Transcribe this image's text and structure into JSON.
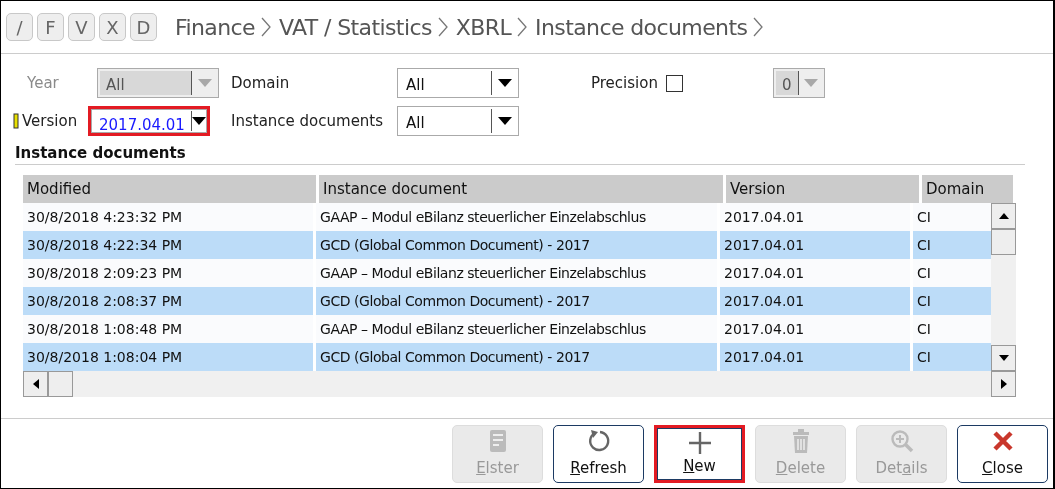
{
  "toolbar": {
    "keys": [
      "/",
      "F",
      "V",
      "X",
      "D"
    ]
  },
  "breadcrumb": [
    "Finance",
    "VAT / Statistics",
    "XBRL",
    "Instance documents"
  ],
  "filters": [
    {
      "kind": "select",
      "label": "Year",
      "value": "All",
      "disabled": true,
      "highlighted": false
    },
    {
      "kind": "select",
      "label": "Domain",
      "value": "All",
      "disabled": false,
      "highlighted": false
    },
    {
      "kind": "checkbox",
      "label": "Precision",
      "checked": false
    },
    {
      "kind": "select",
      "value": "0",
      "disabled": true,
      "highlighted": false
    },
    {
      "kind": "select",
      "label": "Version",
      "value": "2017.04.01",
      "disabled": false,
      "highlighted": true,
      "marked": true
    },
    {
      "kind": "select",
      "label": "Instance documents",
      "value": "All",
      "disabled": false,
      "highlighted": false
    }
  ],
  "section_title": "Instance documents",
  "table": {
    "columns": [
      "Modified",
      "Instance document",
      "Version",
      "Domain"
    ],
    "rows": [
      [
        "30/8/2018 4:23:32 PM",
        "GAAP – Modul eBilanz steuerlicher Einzelabschlus",
        "2017.04.01",
        "CI"
      ],
      [
        "30/8/2018 4:22:34 PM",
        "GCD (Global Common Document) - 2017",
        "2017.04.01",
        "CI"
      ],
      [
        "30/8/2018 2:09:23 PM",
        "GAAP – Modul eBilanz steuerlicher Einzelabschlus",
        "2017.04.01",
        "CI"
      ],
      [
        "30/8/2018 2:08:37 PM",
        "GCD (Global Common Document) - 2017",
        "2017.04.01",
        "CI"
      ],
      [
        "30/8/2018 1:08:48 PM",
        "GAAP – Modul eBilanz steuerlicher Einzelabschlus",
        "2017.04.01",
        "CI"
      ],
      [
        "30/8/2018 1:08:04 PM",
        "GCD (Global Common Document) - 2017",
        "2017.04.01",
        "CI"
      ]
    ]
  },
  "buttons": [
    {
      "kind": "document",
      "key": "E",
      "after": "lster",
      "disabled": true,
      "highlighted": false
    },
    {
      "kind": "refresh",
      "key": "R",
      "after": "efresh",
      "disabled": false,
      "highlighted": false
    },
    {
      "kind": "plus",
      "key": "N",
      "after": "ew",
      "disabled": false,
      "highlighted": true
    },
    {
      "kind": "trash",
      "key": "D",
      "after": "elete",
      "disabled": true,
      "highlighted": false
    },
    {
      "kind": "zoom",
      "before": "Det",
      "key": "a",
      "after": "ils",
      "disabled": true,
      "highlighted": false
    },
    {
      "kind": "close",
      "key": "C",
      "after": "lose",
      "disabled": false,
      "highlighted": false
    }
  ]
}
